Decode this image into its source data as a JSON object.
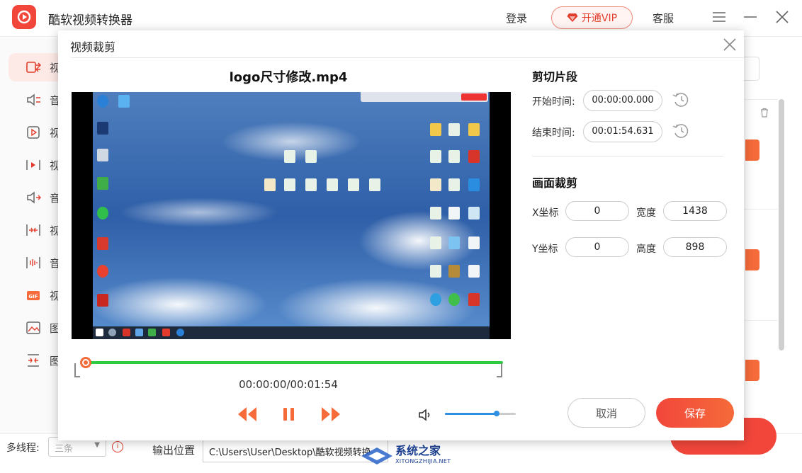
{
  "app": {
    "title": "酷软视频转换器",
    "login": "登录",
    "vip": "开通VIP",
    "service": "客服",
    "brand_color": "#f2463b"
  },
  "sidebar": {
    "items": [
      {
        "label": "视",
        "icon": "video-convert-icon",
        "active": true
      },
      {
        "label": "音",
        "icon": "audio-convert-icon"
      },
      {
        "label": "视",
        "icon": "video-rotate-icon"
      },
      {
        "label": "视",
        "icon": "video-cut-icon"
      },
      {
        "label": "音",
        "icon": "audio-extract-icon"
      },
      {
        "label": "视",
        "icon": "video-merge-icon"
      },
      {
        "label": "音",
        "icon": "audio-merge-icon"
      },
      {
        "label": "视",
        "icon": "gif-icon"
      },
      {
        "label": "图",
        "icon": "image-icon"
      },
      {
        "label": "图",
        "icon": "image-merge-icon"
      }
    ]
  },
  "bottom": {
    "thread_label": "多线程:",
    "thread_value": "三条",
    "output_label": "输出位置",
    "output_path": "C:\\Users\\User\\Desktop\\酷软视频转换"
  },
  "watermark": {
    "text": "系统之家",
    "sub": "XITONGZHIJIA.NET"
  },
  "dialog": {
    "title": "视频裁剪",
    "file_name": "logo尺寸修改.mp4",
    "time_display": "00:00:00/00:01:54",
    "volume_level": 0.73,
    "clip": {
      "section_title": "剪切片段",
      "start_label": "开始时间:",
      "start_value": "00:00:00.000",
      "end_label": "结束时间:",
      "end_value": "00:01:54.631"
    },
    "crop": {
      "section_title": "画面裁剪",
      "x_label": "X坐标",
      "x_value": "0",
      "width_label": "宽度",
      "width_value": "1438",
      "y_label": "Y坐标",
      "y_value": "0",
      "height_label": "高度",
      "height_value": "898"
    },
    "cancel": "取消",
    "save": "保存"
  }
}
